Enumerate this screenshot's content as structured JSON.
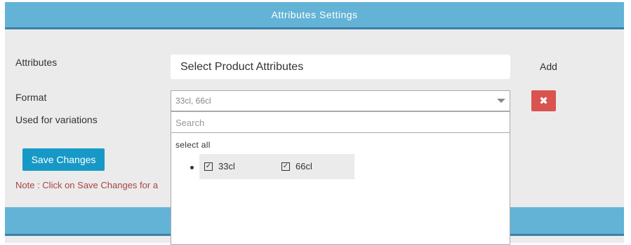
{
  "panel": {
    "title": "Attributes Settings"
  },
  "form": {
    "attributes_label": "Attributes",
    "attributes_value": "Select Product Attributes",
    "add_label": "Add",
    "format_label": "Format",
    "format_value": "33cl, 66cl",
    "used_for_variations_label": "Used for variations",
    "remove_icon": "close-icon"
  },
  "dropdown": {
    "search_placeholder": "Search",
    "select_all_label": "select all",
    "options": [
      {
        "label": "33cl",
        "checked": true
      },
      {
        "label": "66cl",
        "checked": true
      }
    ]
  },
  "actions": {
    "save_label": "Save Changes"
  },
  "note": "Note : Click on Save Changes for a",
  "colors": {
    "header": "#63b3d7",
    "save_button": "#1699c7",
    "remove_button": "#d9534f",
    "note_text": "#a94442"
  }
}
